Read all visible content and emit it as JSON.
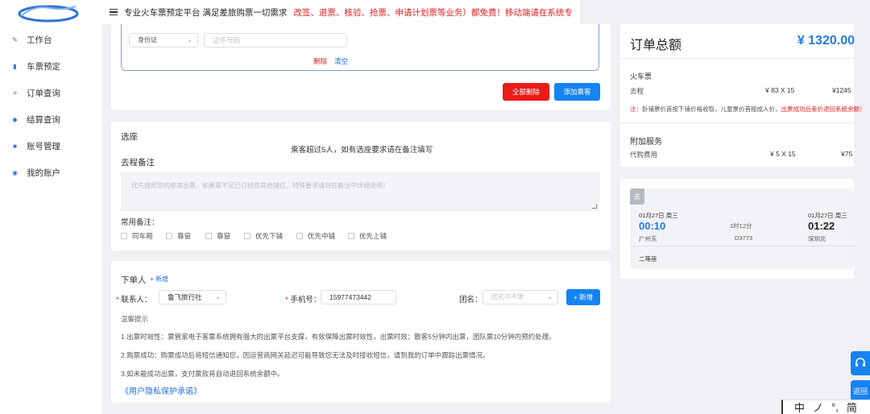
{
  "logo": {
    "text": "鲁票家"
  },
  "nav": [
    {
      "label": "工作台",
      "icon": "workbench-icon"
    },
    {
      "label": "车票预定",
      "icon": "ticket-icon"
    },
    {
      "label": "订单查询",
      "icon": "order-icon"
    },
    {
      "label": "结算查询",
      "icon": "settlement-icon"
    },
    {
      "label": "账号管理",
      "icon": "account-icon"
    },
    {
      "label": "我的账户",
      "icon": "wallet-icon"
    }
  ],
  "topbar": {
    "notice_black": "专业火车票预定平台 满足差旅购票一切需求",
    "notice_red": "改签、退票、核验、抢票、申请计划票等业务）都免费！移动端请在系统专"
  },
  "passenger": {
    "id_type": "身份证",
    "id_placeholder": "证件号码",
    "delete_label": "删除",
    "clear_label": "清空",
    "delete_all_label": "全部删除",
    "add_passenger_label": "添加乘客"
  },
  "seat": {
    "title": "选座",
    "notice": "乘客超过5人，如有选座要求请在备注填写",
    "remark_title": "去程备注",
    "remark_placeholder": "优先按照您的座席出票，如果票不足已订给您其他铺位，特殊要求请到在备注中详细说明！",
    "common_title": "常用备注：",
    "options": [
      "同车厢",
      "靠窗",
      "靠窗",
      "优先下铺",
      "优先中铺",
      "优先上铺"
    ]
  },
  "orderer": {
    "title": "下单人",
    "add_label": "+ 新增",
    "contact_label": "联系人：",
    "contact_value": "鲁飞旅行社",
    "phone_label": "手机号：",
    "phone_value": "15977473442",
    "group_label": "团名：",
    "group_placeholder": "团名可不填",
    "new_button": "+ 新增",
    "tips_title": "温馨提示",
    "tips": [
      "1.出票时效性：票管家电子客票系统拥有强大的出票平台支撑，有效保障出票时效性，出票时效：散客5分钟内出票，团队票10分钟内预约处理。",
      "2.购票成功：购票成功后将短信通知您，因运营商网关延迟可能导致您无法及时接收短信，请到我的订单中跟踪出票情况。",
      "3.如未能成功出票，支付票款将自动退回系统余额中。"
    ],
    "privacy": "《用户隐私保护承诺》"
  },
  "summary": {
    "label": "订单总额",
    "total": "¥ 1320.00",
    "train_title": "火车票",
    "trip_label": "去程",
    "trip_calc": "¥ 83 X 15",
    "trip_amount": "¥1245",
    "note_prefix": "注：",
    "note_black": "卧铺票价首按下铺价格收取，儿童票价首按成人价，",
    "note_red": "出票成功后差价退回系统余额！",
    "addon_title": "附加服务",
    "service_label": "代购费用",
    "service_calc": "¥ 5 X 15",
    "service_amount": "¥75"
  },
  "trip": {
    "badge": "去",
    "depart_date": "01月27日 周三",
    "depart_time": "00:10",
    "depart_station": "广州东",
    "duration": "1时12分",
    "train_no": "D3773",
    "arrive_date": "01月27日 周三",
    "arrive_time": "01:22",
    "arrive_station": "深圳北",
    "seat_class": "二等座"
  },
  "float": {
    "service_icon": "headset-icon",
    "back_label": "返回"
  },
  "ime": [
    "中",
    "ノ",
    "°,",
    "简"
  ],
  "colors": {
    "accent": "#1584f2",
    "danger": "#ea1b1b",
    "total": "#1f7ae8"
  }
}
